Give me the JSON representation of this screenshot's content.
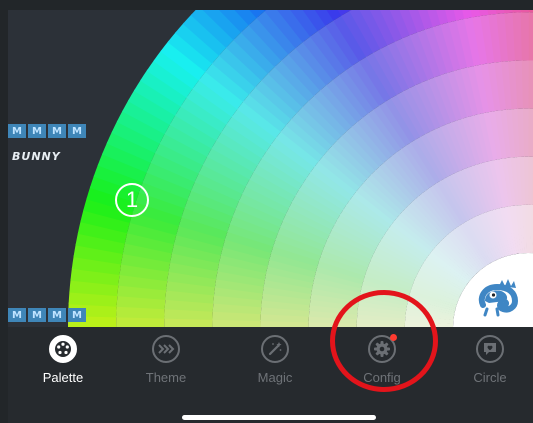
{
  "canvas": {
    "badge_number": "1",
    "bunny_text": "BUNNY",
    "stamp_glyph": "M",
    "stamp_glyph_bottom": "M"
  },
  "tabs": [
    {
      "label": "Palette",
      "icon": "palette-icon",
      "active": true
    },
    {
      "label": "Theme",
      "icon": "chevrons-right-icon",
      "active": false
    },
    {
      "label": "Magic",
      "icon": "magic-wand-icon",
      "active": false
    },
    {
      "label": "Config",
      "icon": "gear-icon",
      "active": false,
      "notification": true
    },
    {
      "label": "Circle",
      "icon": "chat-heart-icon",
      "active": false
    }
  ],
  "colors": {
    "annotation": "#e3141b",
    "notification": "#ff3b30",
    "tabbar": "#262a2e",
    "mascot": "#3f86c4"
  }
}
